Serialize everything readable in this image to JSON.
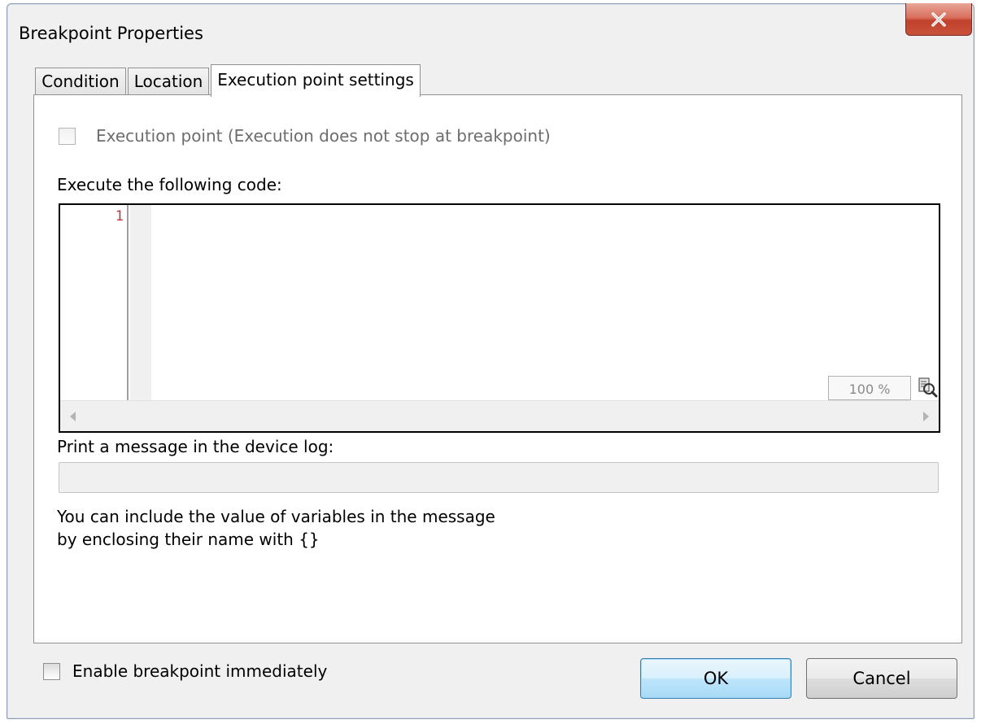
{
  "window": {
    "title": "Breakpoint Properties",
    "close_symbol": "X"
  },
  "tabs": [
    {
      "label": "Condition",
      "active": false
    },
    {
      "label": "Location",
      "active": false
    },
    {
      "label": "Execution point settings",
      "active": true
    }
  ],
  "execution_point": {
    "checkbox_label": "Execution point (Execution does not stop at breakpoint)",
    "checked": false,
    "enabled": false
  },
  "code_section": {
    "label": "Execute the following code:",
    "line_numbers": [
      "1"
    ],
    "zoom_text": "100 %",
    "zoom_icon": "zoom-magnifier-icon"
  },
  "message_section": {
    "label": "Print a message in the device log:",
    "input_value": "",
    "hint_line1": "You can include the value of variables in the message",
    "hint_line2": "by enclosing their name with {}"
  },
  "enable_immediately": {
    "label": "Enable breakpoint immediately",
    "checked": false
  },
  "buttons": {
    "ok": "OK",
    "cancel": "Cancel"
  },
  "colors": {
    "close_button": "#c9523c",
    "line_number": "#b43c3c",
    "default_button_border": "#3c7fb1"
  }
}
